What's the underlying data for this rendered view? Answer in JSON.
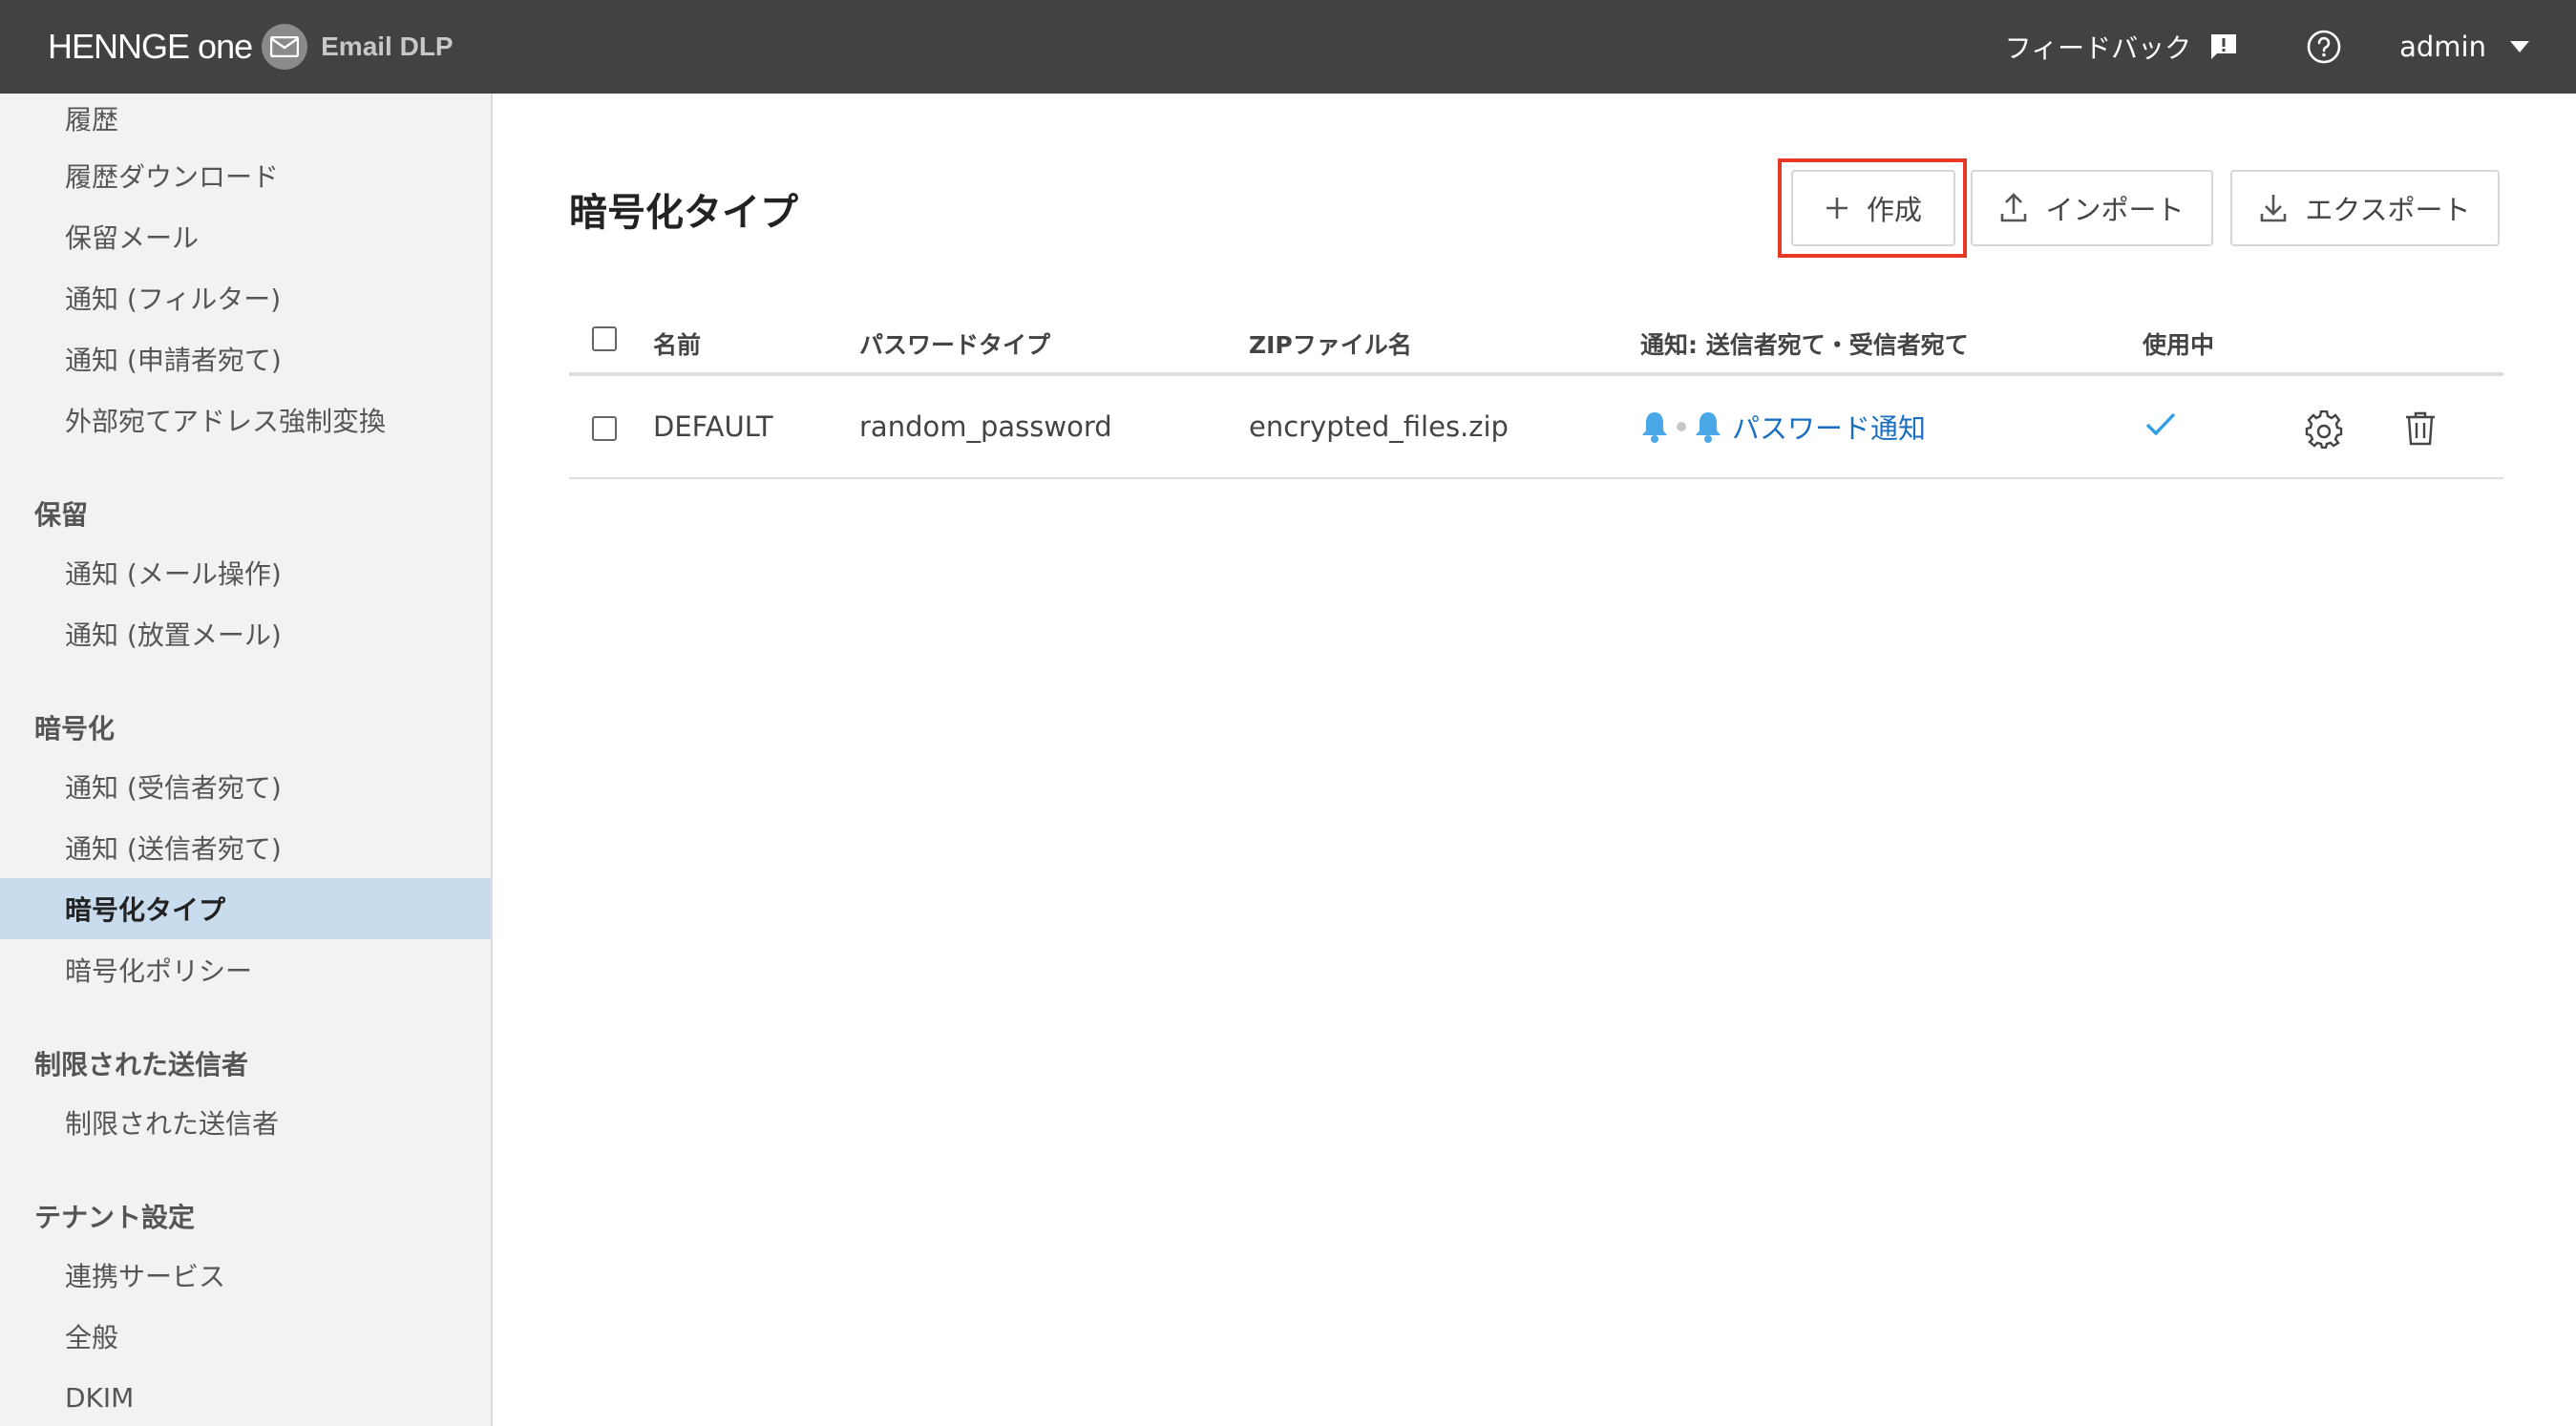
{
  "header": {
    "brand_main": "HENNGE",
    "brand_secondary": "one",
    "product": "Email DLP",
    "feedback_label": "フィードバック",
    "user_label": "admin"
  },
  "sidebar": {
    "items_top": [
      "履歴",
      "履歴ダウンロード",
      "保留メール",
      "通知 (フィルター)",
      "通知 (申請者宛て)",
      "外部宛てアドレス強制変換"
    ],
    "section_hold": "保留",
    "items_hold": [
      "通知 (メール操作)",
      "通知 (放置メール)"
    ],
    "section_encrypt": "暗号化",
    "items_encrypt": [
      "通知 (受信者宛て)",
      "通知 (送信者宛て)",
      "暗号化タイプ",
      "暗号化ポリシー"
    ],
    "section_restricted": "制限された送信者",
    "items_restricted": [
      "制限された送信者"
    ],
    "section_tenant": "テナント設定",
    "items_tenant": [
      "連携サービス",
      "全般",
      "DKIM"
    ],
    "active_item": "暗号化タイプ"
  },
  "main": {
    "title": "暗号化タイプ",
    "buttons": {
      "create": "作成",
      "import": "インポート",
      "export": "エクスポート"
    },
    "table": {
      "columns": [
        "名前",
        "パスワードタイプ",
        "ZIPファイル名",
        "通知: 送信者宛て・受信者宛て",
        "使用中"
      ],
      "rows": [
        {
          "name": "DEFAULT",
          "password_type": "random_password",
          "zip_name": "encrypted_files.zip",
          "notification": "パスワード通知",
          "in_use": true
        }
      ]
    }
  },
  "colors": {
    "topbar": "#424242",
    "accent_link": "#1a6fc0",
    "bell": "#4aa8e8",
    "check": "#2f9ee8",
    "sidebar_active": "#c8dcee",
    "highlight": "#e83828"
  }
}
